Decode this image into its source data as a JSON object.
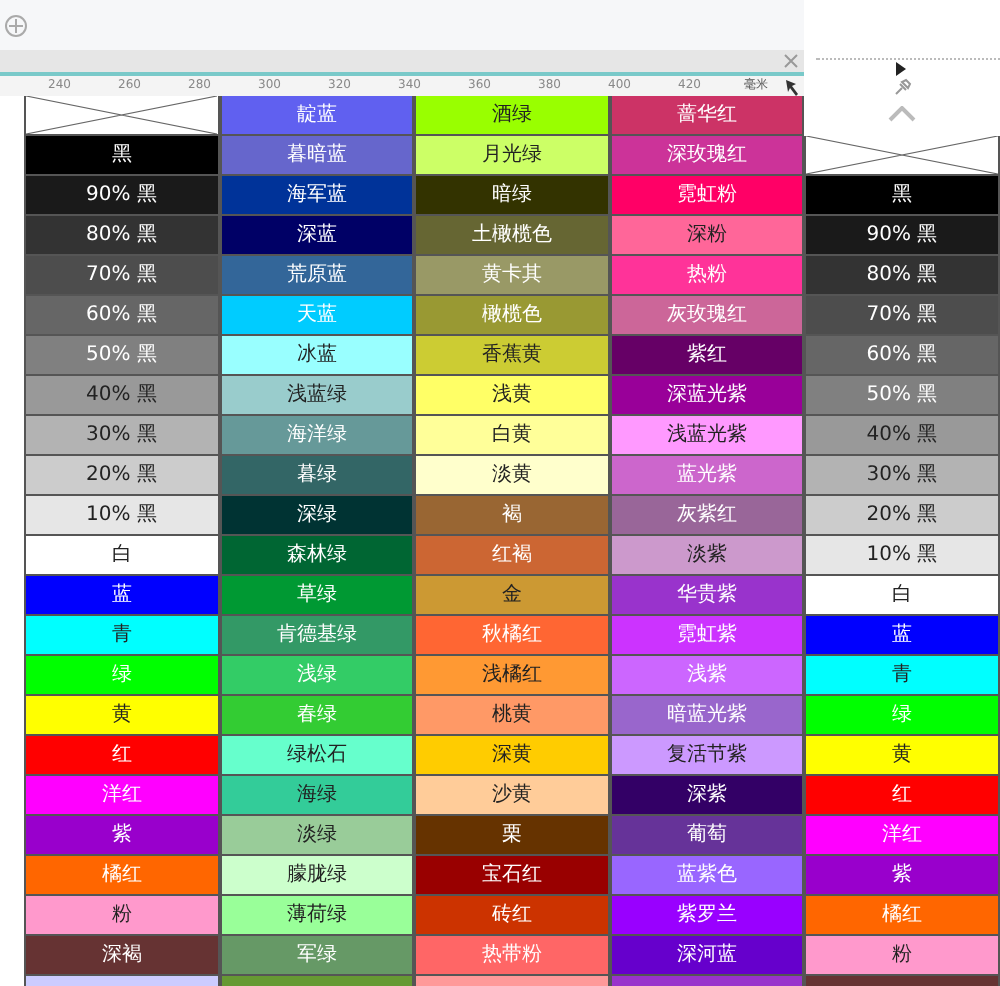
{
  "ruler": {
    "ticks": [
      "240",
      "260",
      "280",
      "300",
      "320",
      "340",
      "360",
      "380",
      "400",
      "420"
    ],
    "unit": "毫米"
  },
  "columns": [
    {
      "cells": [
        {
          "kind": "none"
        },
        {
          "kind": "swatch",
          "label": "黑",
          "color": "#000000"
        },
        {
          "kind": "swatch",
          "label": "90% 黑",
          "color": "#1a1a1a"
        },
        {
          "kind": "swatch",
          "label": "80% 黑",
          "color": "#333333"
        },
        {
          "kind": "swatch",
          "label": "70% 黑",
          "color": "#4d4d4d"
        },
        {
          "kind": "swatch",
          "label": "60% 黑",
          "color": "#666666"
        },
        {
          "kind": "swatch",
          "label": "50% 黑",
          "color": "#808080"
        },
        {
          "kind": "swatch",
          "label": "40% 黑",
          "color": "#999999"
        },
        {
          "kind": "swatch",
          "label": "30% 黑",
          "color": "#b3b3b3"
        },
        {
          "kind": "swatch",
          "label": "20% 黑",
          "color": "#cccccc"
        },
        {
          "kind": "swatch",
          "label": "10% 黑",
          "color": "#e6e6e6"
        },
        {
          "kind": "swatch",
          "label": "白",
          "color": "#ffffff"
        },
        {
          "kind": "swatch",
          "label": "蓝",
          "color": "#0000ff"
        },
        {
          "kind": "swatch",
          "label": "青",
          "color": "#00ffff"
        },
        {
          "kind": "swatch",
          "label": "绿",
          "color": "#00ff00"
        },
        {
          "kind": "swatch",
          "label": "黄",
          "color": "#ffff00"
        },
        {
          "kind": "swatch",
          "label": "红",
          "color": "#ff0000"
        },
        {
          "kind": "swatch",
          "label": "洋红",
          "color": "#ff00ff"
        },
        {
          "kind": "swatch",
          "label": "紫",
          "color": "#9900cc"
        },
        {
          "kind": "swatch",
          "label": "橘红",
          "color": "#ff6600"
        },
        {
          "kind": "swatch",
          "label": "粉",
          "color": "#ff99cc"
        },
        {
          "kind": "swatch",
          "label": "深褐",
          "color": "#663333"
        },
        {
          "kind": "swatch",
          "color": "#ccccff"
        }
      ]
    },
    {
      "cells": [
        {
          "kind": "swatch",
          "label": "靛蓝",
          "color": "#6060f0"
        },
        {
          "kind": "swatch",
          "label": "暮暗蓝",
          "color": "#6666cc"
        },
        {
          "kind": "swatch",
          "label": "海军蓝",
          "color": "#003399"
        },
        {
          "kind": "swatch",
          "label": "深蓝",
          "color": "#000066"
        },
        {
          "kind": "swatch",
          "label": "荒原蓝",
          "color": "#336699"
        },
        {
          "kind": "swatch",
          "label": "天蓝",
          "color": "#00ccff"
        },
        {
          "kind": "swatch",
          "label": "冰蓝",
          "color": "#99ffff"
        },
        {
          "kind": "swatch",
          "label": "浅蓝绿",
          "color": "#99cccc"
        },
        {
          "kind": "swatch",
          "label": "海洋绿",
          "color": "#669999"
        },
        {
          "kind": "swatch",
          "label": "暮绿",
          "color": "#336666"
        },
        {
          "kind": "swatch",
          "label": "深绿",
          "color": "#003333"
        },
        {
          "kind": "swatch",
          "label": "森林绿",
          "color": "#006633"
        },
        {
          "kind": "swatch",
          "label": "草绿",
          "color": "#009933"
        },
        {
          "kind": "swatch",
          "label": "肯德基绿",
          "color": "#339966"
        },
        {
          "kind": "swatch",
          "label": "浅绿",
          "color": "#33cc66"
        },
        {
          "kind": "swatch",
          "label": "春绿",
          "color": "#33cc33"
        },
        {
          "kind": "swatch",
          "label": "绿松石",
          "color": "#66ffcc"
        },
        {
          "kind": "swatch",
          "label": "海绿",
          "color": "#33cc99"
        },
        {
          "kind": "swatch",
          "label": "淡绿",
          "color": "#99cc99"
        },
        {
          "kind": "swatch",
          "label": "朦胧绿",
          "color": "#ccffcc"
        },
        {
          "kind": "swatch",
          "label": "薄荷绿",
          "color": "#99ff99"
        },
        {
          "kind": "swatch",
          "label": "军绿",
          "color": "#669966"
        },
        {
          "kind": "swatch",
          "color": "#669933"
        }
      ]
    },
    {
      "cells": [
        {
          "kind": "swatch",
          "label": "酒绿",
          "color": "#99ff00"
        },
        {
          "kind": "swatch",
          "label": "月光绿",
          "color": "#ccff66"
        },
        {
          "kind": "swatch",
          "label": "暗绿",
          "color": "#333300"
        },
        {
          "kind": "swatch",
          "label": "土橄榄色",
          "color": "#666633"
        },
        {
          "kind": "swatch",
          "label": "黄卡其",
          "color": "#999966"
        },
        {
          "kind": "swatch",
          "label": "橄榄色",
          "color": "#999933"
        },
        {
          "kind": "swatch",
          "label": "香蕉黄",
          "color": "#cccc33"
        },
        {
          "kind": "swatch",
          "label": "浅黄",
          "color": "#ffff66"
        },
        {
          "kind": "swatch",
          "label": "白黄",
          "color": "#ffff99"
        },
        {
          "kind": "swatch",
          "label": "淡黄",
          "color": "#ffffcc"
        },
        {
          "kind": "swatch",
          "label": "褐",
          "color": "#996633"
        },
        {
          "kind": "swatch",
          "label": "红褐",
          "color": "#cc6633"
        },
        {
          "kind": "swatch",
          "label": "金",
          "color": "#cc9933"
        },
        {
          "kind": "swatch",
          "label": "秋橘红",
          "color": "#ff6633"
        },
        {
          "kind": "swatch",
          "label": "浅橘红",
          "color": "#ff9933"
        },
        {
          "kind": "swatch",
          "label": "桃黄",
          "color": "#ff9966"
        },
        {
          "kind": "swatch",
          "label": "深黄",
          "color": "#ffcc00"
        },
        {
          "kind": "swatch",
          "label": "沙黄",
          "color": "#ffcc99"
        },
        {
          "kind": "swatch",
          "label": "栗",
          "color": "#663300"
        },
        {
          "kind": "swatch",
          "label": "宝石红",
          "color": "#990000"
        },
        {
          "kind": "swatch",
          "label": "砖红",
          "color": "#cc3300"
        },
        {
          "kind": "swatch",
          "label": "热带粉",
          "color": "#ff6666"
        },
        {
          "kind": "swatch",
          "color": "#ff9999"
        }
      ]
    },
    {
      "cells": [
        {
          "kind": "swatch",
          "label": "蔷华红",
          "color": "#cc3366"
        },
        {
          "kind": "swatch",
          "label": "深玫瑰红",
          "color": "#cc3399"
        },
        {
          "kind": "swatch",
          "label": "霓虹粉",
          "color": "#ff0066"
        },
        {
          "kind": "swatch",
          "label": "深粉",
          "color": "#ff6699"
        },
        {
          "kind": "swatch",
          "label": "热粉",
          "color": "#ff3399"
        },
        {
          "kind": "swatch",
          "label": "灰玫瑰红",
          "color": "#cc6699"
        },
        {
          "kind": "swatch",
          "label": "紫红",
          "color": "#660066"
        },
        {
          "kind": "swatch",
          "label": "深蓝光紫",
          "color": "#990099"
        },
        {
          "kind": "swatch",
          "label": "浅蓝光紫",
          "color": "#ff99ff"
        },
        {
          "kind": "swatch",
          "label": "蓝光紫",
          "color": "#cc66cc"
        },
        {
          "kind": "swatch",
          "label": "灰紫红",
          "color": "#996699"
        },
        {
          "kind": "swatch",
          "label": "淡紫",
          "color": "#cc99cc"
        },
        {
          "kind": "swatch",
          "label": "华贵紫",
          "color": "#9933cc"
        },
        {
          "kind": "swatch",
          "label": "霓虹紫",
          "color": "#cc33ff"
        },
        {
          "kind": "swatch",
          "label": "浅紫",
          "color": "#cc66ff"
        },
        {
          "kind": "swatch",
          "label": "暗蓝光紫",
          "color": "#9966cc"
        },
        {
          "kind": "swatch",
          "label": "复活节紫",
          "color": "#cc99ff"
        },
        {
          "kind": "swatch",
          "label": "深紫",
          "color": "#330066"
        },
        {
          "kind": "swatch",
          "label": "葡萄",
          "color": "#663399"
        },
        {
          "kind": "swatch",
          "label": "蓝紫色",
          "color": "#9966ff"
        },
        {
          "kind": "swatch",
          "label": "紫罗兰",
          "color": "#9900ff"
        },
        {
          "kind": "swatch",
          "label": "深河蓝",
          "color": "#6600cc"
        },
        {
          "kind": "swatch",
          "color": "#9933cc"
        }
      ]
    },
    {
      "cells": [
        {
          "kind": "none"
        },
        {
          "kind": "swatch",
          "label": "黑",
          "color": "#000000"
        },
        {
          "kind": "swatch",
          "label": "90% 黑",
          "color": "#1a1a1a"
        },
        {
          "kind": "swatch",
          "label": "80% 黑",
          "color": "#333333"
        },
        {
          "kind": "swatch",
          "label": "70% 黑",
          "color": "#4d4d4d"
        },
        {
          "kind": "swatch",
          "label": "60% 黑",
          "color": "#666666"
        },
        {
          "kind": "swatch",
          "label": "50% 黑",
          "color": "#808080"
        },
        {
          "kind": "swatch",
          "label": "40% 黑",
          "color": "#999999"
        },
        {
          "kind": "swatch",
          "label": "30% 黑",
          "color": "#b3b3b3"
        },
        {
          "kind": "swatch",
          "label": "20% 黑",
          "color": "#cccccc"
        },
        {
          "kind": "swatch",
          "label": "10% 黑",
          "color": "#e6e6e6"
        },
        {
          "kind": "swatch",
          "label": "白",
          "color": "#ffffff"
        },
        {
          "kind": "swatch",
          "label": "蓝",
          "color": "#0000ff"
        },
        {
          "kind": "swatch",
          "label": "青",
          "color": "#00ffff"
        },
        {
          "kind": "swatch",
          "label": "绿",
          "color": "#00ff00"
        },
        {
          "kind": "swatch",
          "label": "黄",
          "color": "#ffff00"
        },
        {
          "kind": "swatch",
          "label": "红",
          "color": "#ff0000"
        },
        {
          "kind": "swatch",
          "label": "洋红",
          "color": "#ff00ff"
        },
        {
          "kind": "swatch",
          "label": "紫",
          "color": "#9900cc"
        },
        {
          "kind": "swatch",
          "label": "橘红",
          "color": "#ff6600"
        },
        {
          "kind": "swatch",
          "label": "粉",
          "color": "#ff99cc"
        },
        {
          "kind": "swatch",
          "color": "#663333"
        }
      ]
    }
  ]
}
